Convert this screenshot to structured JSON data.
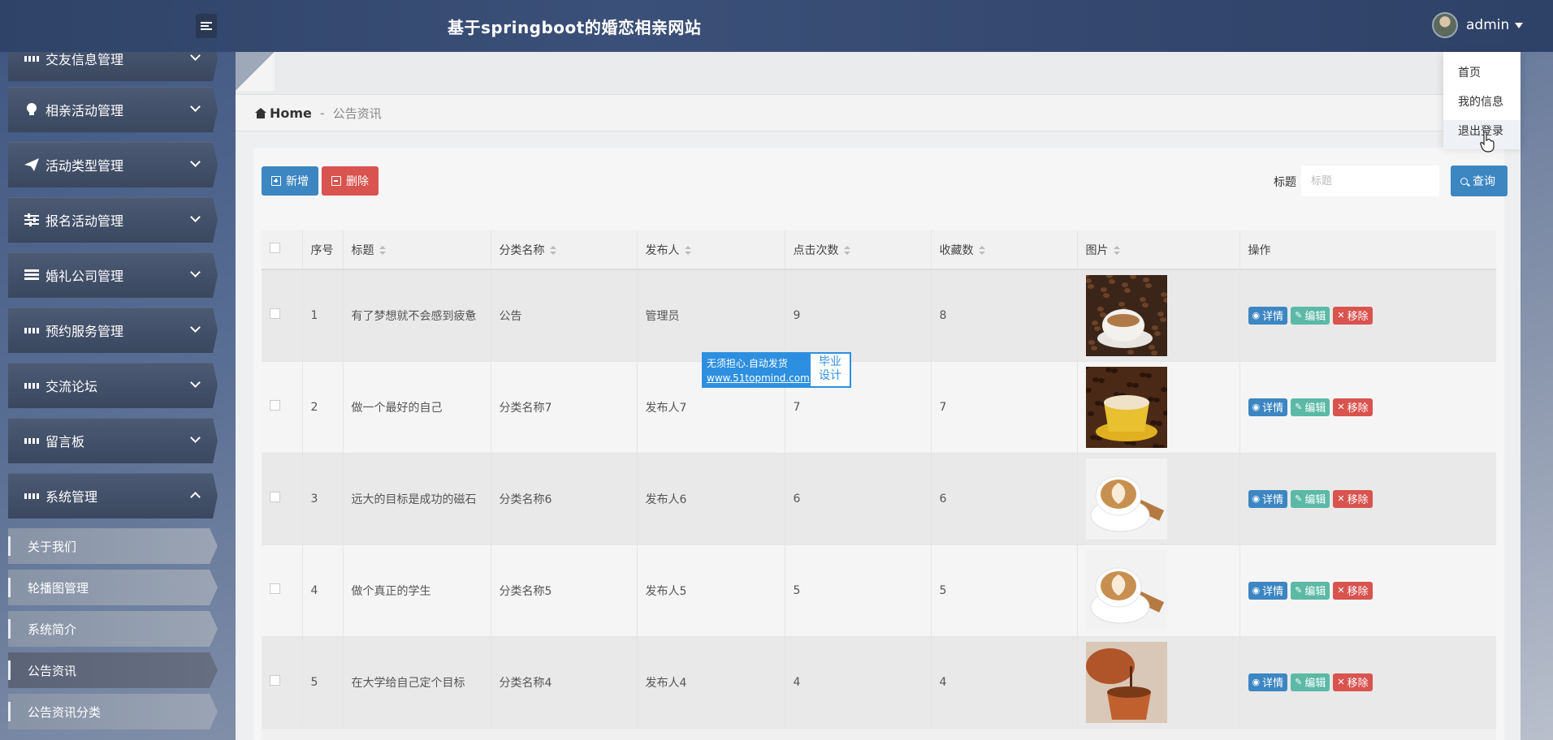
{
  "header": {
    "title": "基于springboot的婚恋相亲网站",
    "username": "admin"
  },
  "user_menu": [
    {
      "label": "首页"
    },
    {
      "label": "我的信息"
    },
    {
      "label": "退出登录"
    }
  ],
  "sidebar": {
    "menus": [
      {
        "label": "交友信息管理",
        "icon": "grid-icon"
      },
      {
        "label": "相亲活动管理",
        "icon": "lightbulb-icon"
      },
      {
        "label": "活动类型管理",
        "icon": "paper-plane-icon"
      },
      {
        "label": "报名活动管理",
        "icon": "sliders-icon"
      },
      {
        "label": "婚礼公司管理",
        "icon": "server-icon"
      },
      {
        "label": "预约服务管理",
        "icon": "grid-icon"
      },
      {
        "label": "交流论坛",
        "icon": "grid-icon"
      },
      {
        "label": "留言板",
        "icon": "grid-icon"
      },
      {
        "label": "系统管理",
        "icon": "grid-icon"
      }
    ],
    "sub_items": [
      {
        "label": "关于我们"
      },
      {
        "label": "轮播图管理"
      },
      {
        "label": "系统简介"
      },
      {
        "label": "公告资讯"
      },
      {
        "label": "公告资讯分类"
      }
    ]
  },
  "breadcrumb": {
    "home": "Home",
    "separator": "-",
    "current": "公告资讯"
  },
  "toolbar": {
    "add_label": "新增",
    "delete_label": "删除",
    "search_label": "标题",
    "search_placeholder": "标题",
    "search_button": "查询"
  },
  "table": {
    "columns": [
      "序号",
      "标题",
      "分类名称",
      "发布人",
      "点击次数",
      "收藏数",
      "图片",
      "操作"
    ],
    "rows": [
      {
        "index": "1",
        "title": "有了梦想就不会感到疲惫",
        "category": "公告",
        "publisher": "管理员",
        "clicks": "9",
        "favorites": "8",
        "image": "coffee-beans-cup"
      },
      {
        "index": "2",
        "title": "做一个最好的自己",
        "category": "分类名称7",
        "publisher": "发布人7",
        "clicks": "7",
        "favorites": "7",
        "image": "yellow-coffee-cup"
      },
      {
        "index": "3",
        "title": "远大的目标是成功的磁石",
        "category": "分类名称6",
        "publisher": "发布人6",
        "clicks": "6",
        "favorites": "6",
        "image": "latte-art-cup"
      },
      {
        "index": "4",
        "title": "做个真正的学生",
        "category": "分类名称5",
        "publisher": "发布人5",
        "clicks": "5",
        "favorites": "5",
        "image": "latte-art-cup"
      },
      {
        "index": "5",
        "title": "在大学给自己定个目标",
        "category": "分类名称4",
        "publisher": "发布人4",
        "clicks": "4",
        "favorites": "4",
        "image": "pouring-coffee-pot"
      }
    ],
    "actions": {
      "detail": "详情",
      "edit": "编辑",
      "remove": "移除"
    }
  },
  "watermark": {
    "line1": "无须担心.自动发货",
    "line2": "www.51topmind.com",
    "right1": "毕业",
    "right2": "设计"
  }
}
